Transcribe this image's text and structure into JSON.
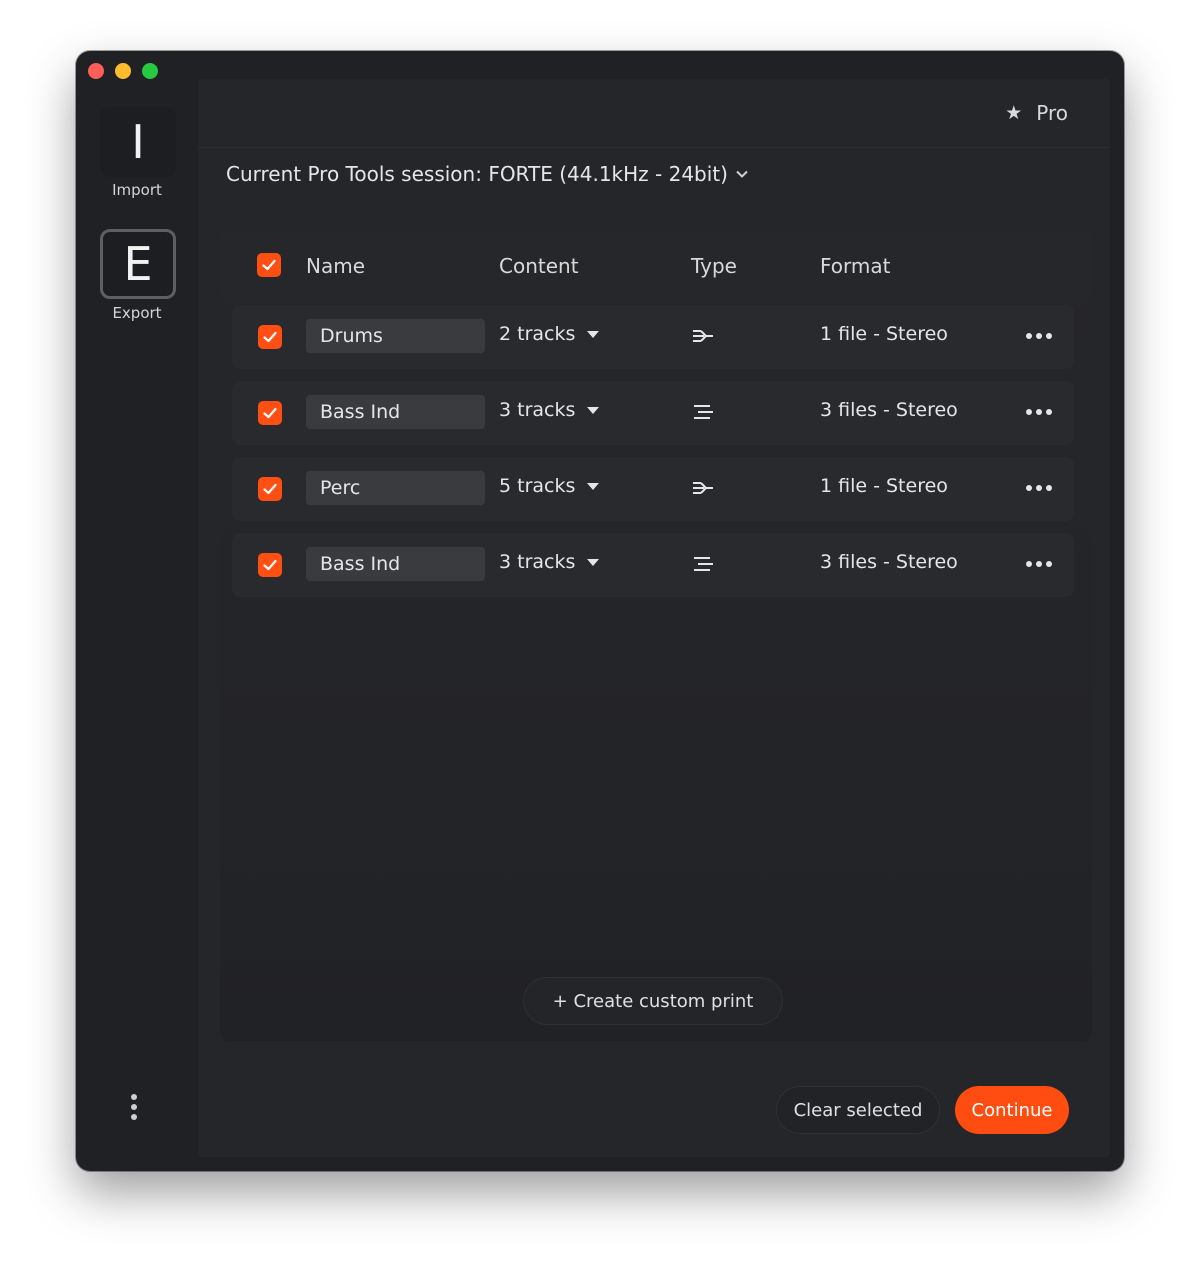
{
  "sidebar": {
    "import": {
      "letter": "I",
      "label": "Import"
    },
    "export": {
      "letter": "E",
      "label": "Export"
    }
  },
  "header": {
    "pro_label": "Pro"
  },
  "session": {
    "label": "Current Pro Tools session: FORTE (44.1kHz - 24bit)"
  },
  "table": {
    "columns": {
      "name": "Name",
      "content": "Content",
      "type": "Type",
      "format": "Format"
    },
    "rows": [
      {
        "name": "Drums",
        "content": "2 tracks",
        "type_icon": "arrow-merge-icon",
        "format": "1 file - Stereo",
        "checked": true
      },
      {
        "name": "Bass Ind",
        "content": "3 tracks",
        "type_icon": "lines-split-icon",
        "format": "3 files - Stereo",
        "checked": true
      },
      {
        "name": "Perc",
        "content": "5 tracks",
        "type_icon": "arrow-merge-icon",
        "format": "1 file - Stereo",
        "checked": true
      },
      {
        "name": "Bass Ind",
        "content": "3 tracks",
        "type_icon": "lines-split-icon",
        "format": "3 files - Stereo",
        "checked": true
      }
    ]
  },
  "actions": {
    "create_custom": "+ Create custom print",
    "clear_selected": "Clear selected",
    "continue": "Continue"
  },
  "colors": {
    "accent": "#ff4c10",
    "background": "#202124",
    "panel": "#25262a"
  }
}
